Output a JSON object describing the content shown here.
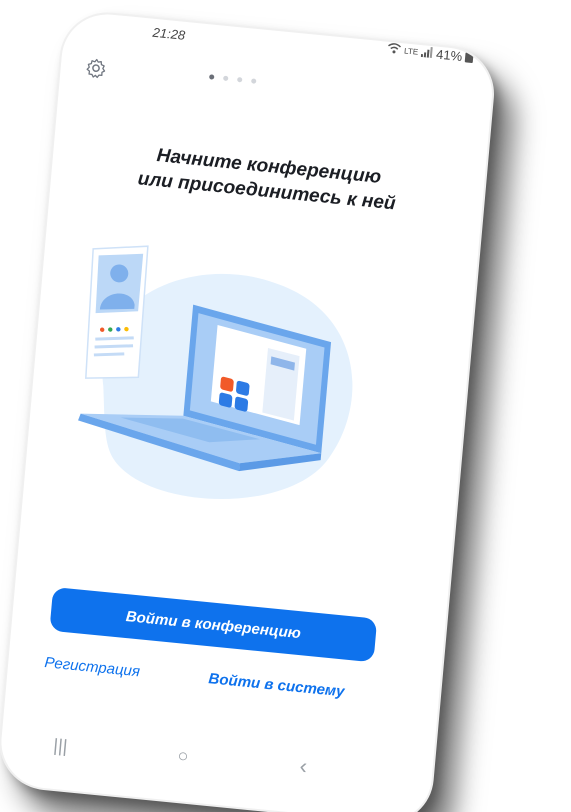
{
  "status_bar": {
    "time": "21:28",
    "battery": "41%",
    "network": "LTE"
  },
  "pager": {
    "total": 4,
    "active": 0
  },
  "headline": {
    "line1": "Начните конференцию",
    "line2": "или присоединитесь к ней"
  },
  "buttons": {
    "join_meeting": "Войти в конференцию"
  },
  "links": {
    "register": "Регистрация",
    "sign_in": "Войти в систему"
  },
  "nav": {
    "recent": "|||",
    "home": "○",
    "back": "‹"
  },
  "colors": {
    "accent": "#0e72ed",
    "illustration_bg": "#e4f1fd",
    "illustration_mid": "#b3d4f6",
    "illustration_dark": "#5b9ae6"
  }
}
